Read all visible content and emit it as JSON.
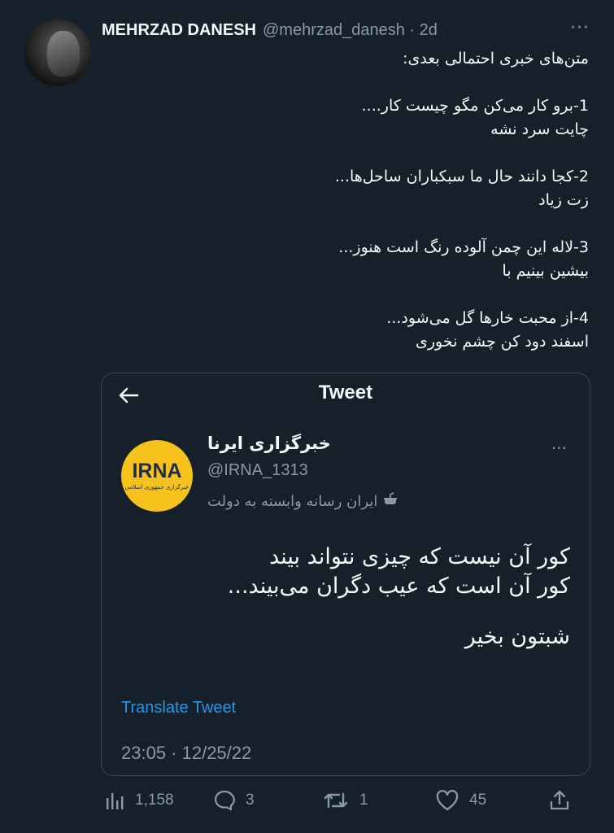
{
  "tweet": {
    "author_name": "MEHRZAD DANESH",
    "handle": "@mehrzad_danesh · 2d",
    "more": "···",
    "lines": [
      "متن‌های خبری احتمالی بعدی:",
      "",
      "1-برو کار می‌کن مگو چیست کار....",
      "چایت سرد نشه",
      "",
      "2-کجا دانند حال ما سبکباران ساحل‌ها...",
      "زت زیاد",
      "",
      "3-لاله این چمن آلوده رنگ است هنوز...",
      "بیشین بینیم با",
      "",
      "4-از محبت خارها گل می‌شود...",
      "اسفند دود کن چشم نخوری"
    ]
  },
  "quoted": {
    "header_title": "Tweet",
    "back_icon": "arrow-left-icon",
    "logo_word": "IRNA",
    "logo_sub": "خبرگزاری جمهوری اسلامی",
    "name": "خبرگزاری ایرنا",
    "handle": "@IRNA_1313",
    "label": "ایران رسانه وابسته به دولت",
    "more": "···",
    "text_lines": [
      "کور آن نیست که چیزی نتواند بیند",
      "کور آن است که عیب دگران می‌بیند...",
      "",
      "شبتون بخیر"
    ],
    "translate": "Translate Tweet",
    "timestamp": "23:05 · 12/25/22"
  },
  "actions": {
    "views": "1,158",
    "replies": "3",
    "retweets": "1",
    "likes": "45"
  },
  "colors": {
    "background": "#15202b",
    "link": "#1d9bf0",
    "muted": "#8b98a5",
    "irna_yellow": "#f6c21b"
  }
}
